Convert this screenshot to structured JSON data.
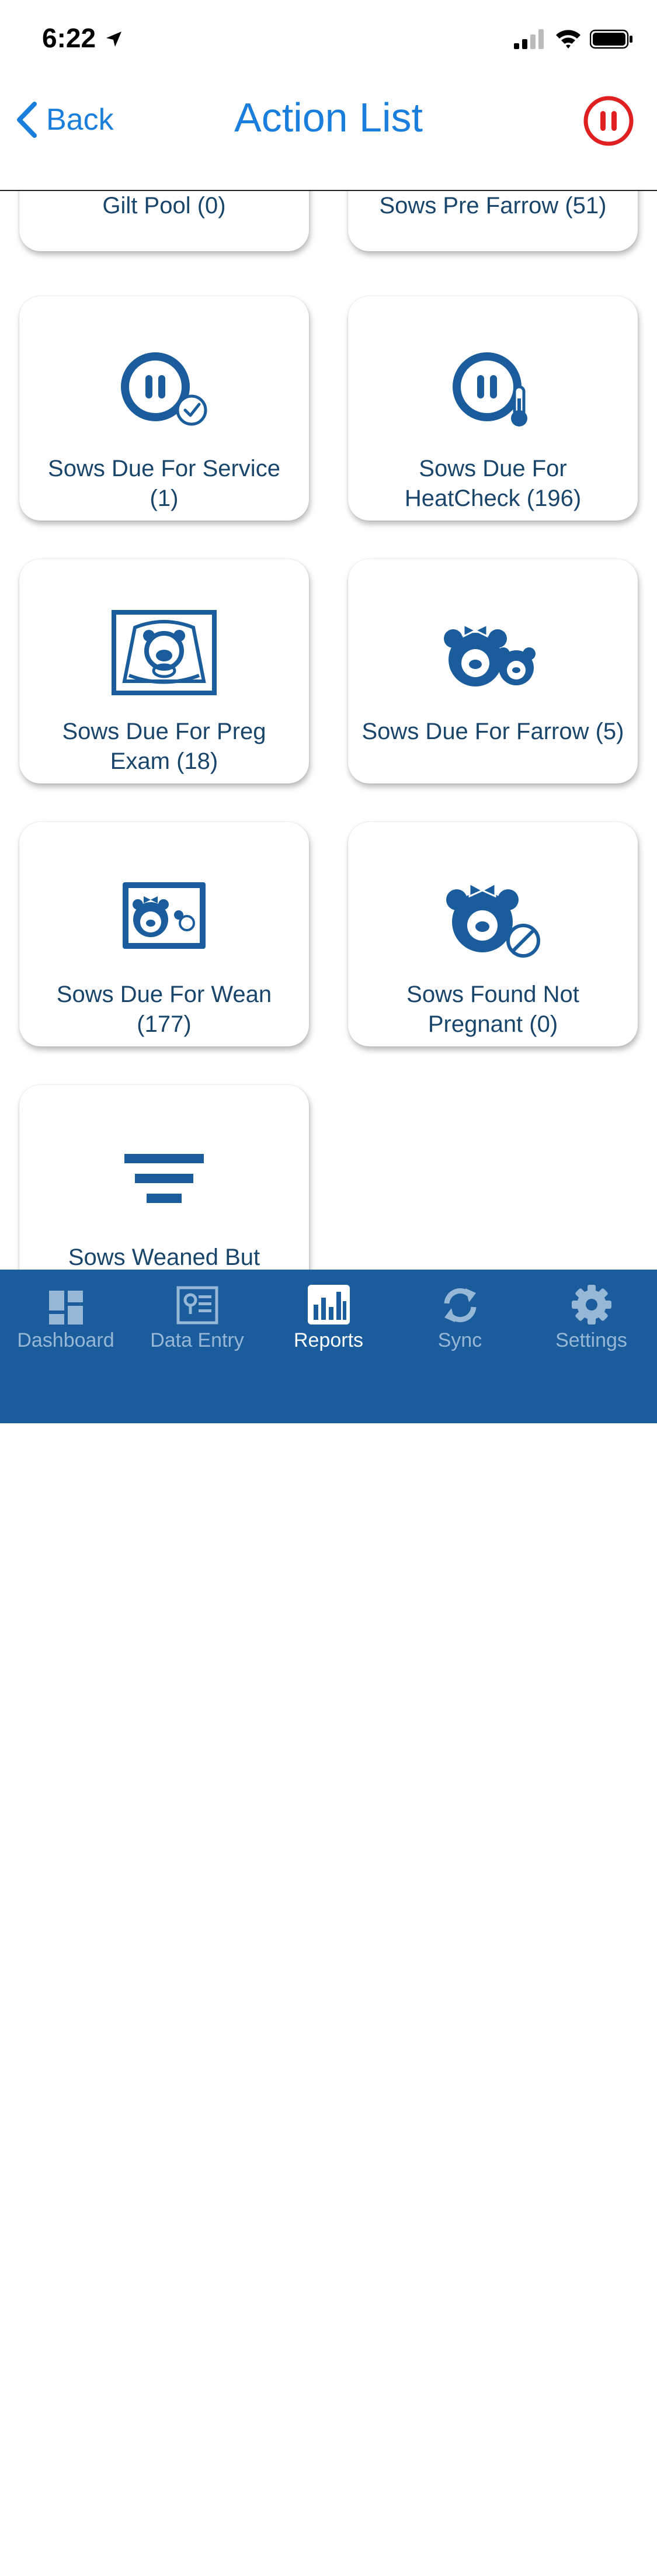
{
  "status": {
    "time": "6:22"
  },
  "nav": {
    "back_label": "Back",
    "title": "Action List"
  },
  "cards": [
    {
      "label": "Gilt Pool (0)",
      "icon": "gilt-pool-icon"
    },
    {
      "label": "Sows Pre Farrow (51)",
      "icon": "sow-pre-farrow-icon"
    },
    {
      "label": "Sows Due For Service (1)",
      "icon": "pig-checkmark-icon"
    },
    {
      "label": "Sows Due For HeatCheck (196)",
      "icon": "pig-thermometer-icon"
    },
    {
      "label": "Sows Due For Preg Exam (18)",
      "icon": "ultrasound-pig-icon"
    },
    {
      "label": "Sows Due For Farrow (5)",
      "icon": "sow-and-piglet-icon"
    },
    {
      "label": "Sows Due For Wean (177)",
      "icon": "sow-wean-screen-icon"
    },
    {
      "label": "Sows Found Not Pregnant (0)",
      "icon": "sow-not-pregnant-icon"
    },
    {
      "label": "Sows Weaned But",
      "icon": "filter-icon"
    }
  ],
  "tabs": [
    {
      "label": "Dashboard",
      "icon": "dashboard-icon"
    },
    {
      "label": "Data Entry",
      "icon": "data-entry-icon"
    },
    {
      "label": "Reports",
      "icon": "reports-icon",
      "active": true
    },
    {
      "label": "Sync",
      "icon": "sync-icon"
    },
    {
      "label": "Settings",
      "icon": "gear-icon"
    }
  ],
  "colors": {
    "accent": "#1a7fdc",
    "icon_blue": "#1a5c9c",
    "tab_bar": "#1a5c9c",
    "alert_red": "#e02020"
  }
}
